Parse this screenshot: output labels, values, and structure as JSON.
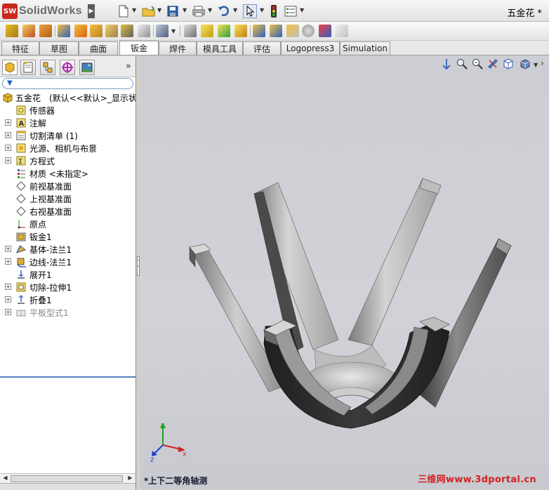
{
  "app": {
    "logo_text": "SolidWorks",
    "logo_mark": "SW",
    "document_title": "五金花 *"
  },
  "tabs": [
    {
      "label": "特征"
    },
    {
      "label": "草图"
    },
    {
      "label": "曲面"
    },
    {
      "label": "钣金",
      "active": true
    },
    {
      "label": "焊件"
    },
    {
      "label": "模具工具"
    },
    {
      "label": "评估"
    },
    {
      "label": "Logopress3"
    },
    {
      "label": "Simulation"
    }
  ],
  "feature_tree": {
    "root": "五金花　(默认<<默认>_显示状态",
    "items": [
      {
        "label": "传感器",
        "icon": "sensor-icon",
        "expandable": false
      },
      {
        "label": "注解",
        "icon": "annotation-icon",
        "expandable": true
      },
      {
        "label": "切割清单 (1)",
        "icon": "cut-list-icon",
        "expandable": true
      },
      {
        "label": "光源、相机与布景",
        "icon": "lights-cameras-icon",
        "expandable": true
      },
      {
        "label": "方程式",
        "icon": "equation-icon",
        "expandable": true
      },
      {
        "label": "材质 <未指定>",
        "icon": "material-icon",
        "expandable": false
      },
      {
        "label": "前视基准面",
        "icon": "plane-icon",
        "expandable": false
      },
      {
        "label": "上视基准面",
        "icon": "plane-icon",
        "expandable": false
      },
      {
        "label": "右视基准面",
        "icon": "plane-icon",
        "expandable": false
      },
      {
        "label": "原点",
        "icon": "origin-icon",
        "expandable": false
      },
      {
        "label": "钣金1",
        "icon": "sheet-metal-icon",
        "expandable": false
      },
      {
        "label": "基体-法兰1",
        "icon": "base-flange-icon",
        "expandable": true
      },
      {
        "label": "边线-法兰1",
        "icon": "edge-flange-icon",
        "expandable": true
      },
      {
        "label": "展开1",
        "icon": "unfold-icon",
        "expandable": false
      },
      {
        "label": "切除-拉伸1",
        "icon": "cut-extrude-icon",
        "expandable": true
      },
      {
        "label": "折叠1",
        "icon": "fold-icon",
        "expandable": true
      },
      {
        "label": "平板型式1",
        "icon": "flat-pattern-icon",
        "expandable": true,
        "suppressed": true
      }
    ]
  },
  "viewport": {
    "view_name": "*上下二等角轴测",
    "watermark": "三维网www.3dportal.cn",
    "triad": {
      "x": "X",
      "y": "Y",
      "z": "Z"
    }
  },
  "colors": {
    "viewport_bg": "#ccced4",
    "part_light": "#c8c8c8",
    "part_dark": "#2a2a2a",
    "logo_red": "#c8281e",
    "watermark_red": "#d42020"
  }
}
